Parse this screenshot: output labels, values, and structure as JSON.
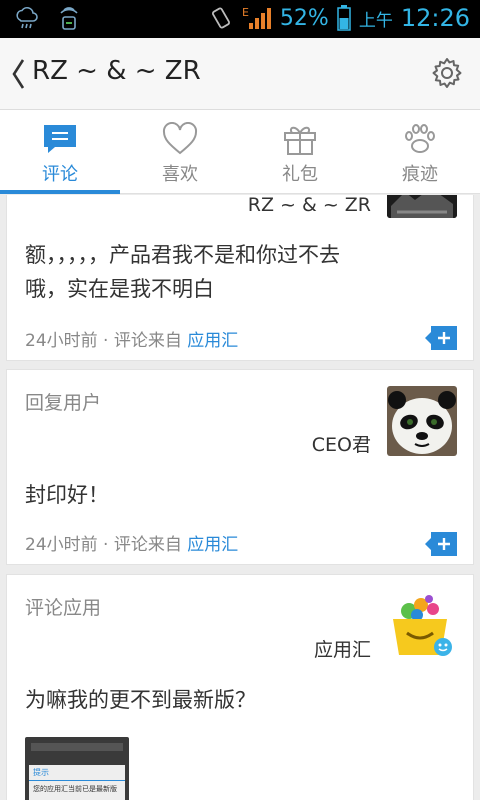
{
  "status": {
    "battery_pct": "52%",
    "ampm": "上午",
    "time": "12:26"
  },
  "header": {
    "title": "RZ ~ & ~ ZR"
  },
  "tabs": [
    {
      "label": "评论",
      "icon": "comment-icon",
      "active": true
    },
    {
      "label": "喜欢",
      "icon": "heart-icon",
      "active": false
    },
    {
      "label": "礼包",
      "icon": "gift-icon",
      "active": false
    },
    {
      "label": "痕迹",
      "icon": "pawprint-icon",
      "active": false
    }
  ],
  "cards": [
    {
      "user": "RZ ~ & ~ ZR",
      "body_line1": "额，，，，，产品君我不是和你过不去",
      "body_line2": "哦，实在是我不明白",
      "time": "24小时前 · 评论来自",
      "source": "应用汇"
    },
    {
      "type": "回复用户",
      "user": "CEO君",
      "body": "封印好！",
      "time": "24小时前 · 评论来自",
      "source": "应用汇"
    },
    {
      "type": "评论应用",
      "user": "应用汇",
      "body": "为嘛我的更不到最新版？",
      "thumb_title": "提示",
      "thumb_text": "您的应用汇当前已是最新版"
    }
  ],
  "colors": {
    "accent": "#2a8ad8",
    "statusbar_icon": "#33b5e5",
    "battery_warn": "#e63b2e"
  }
}
